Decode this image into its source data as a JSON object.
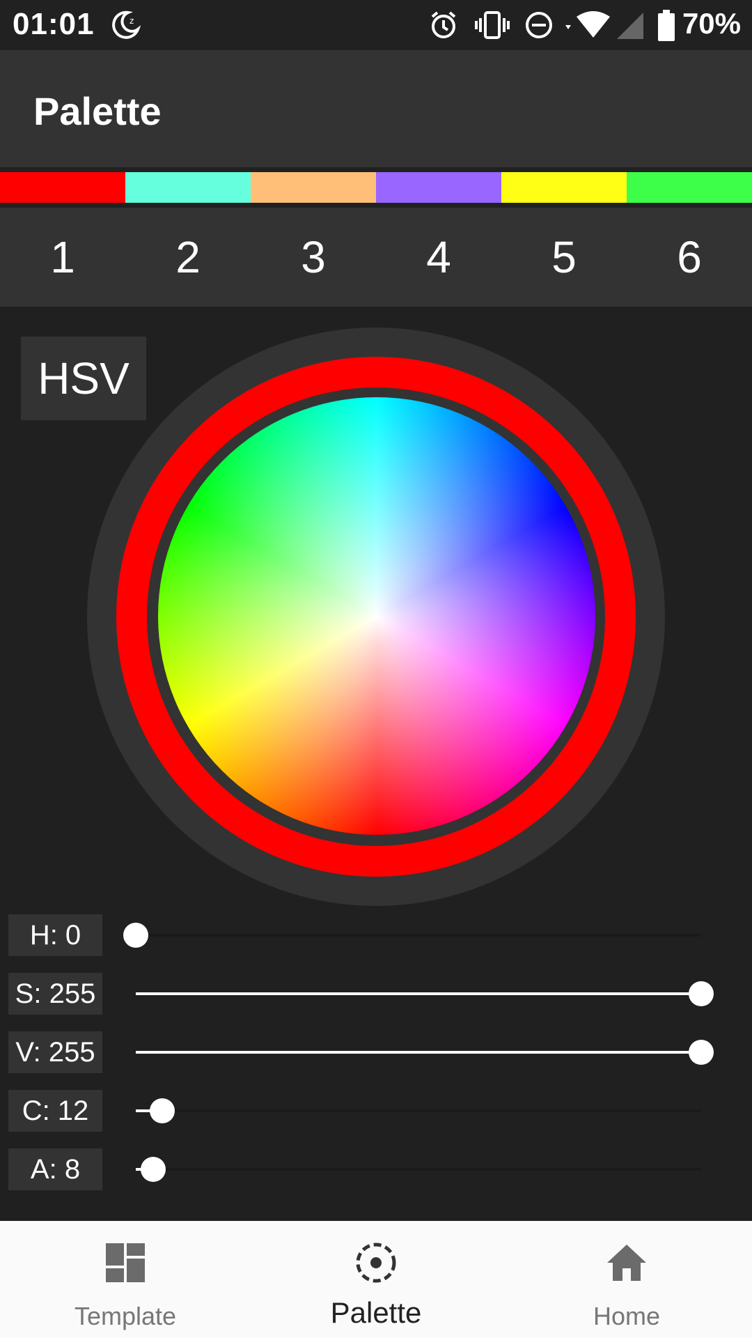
{
  "status_bar": {
    "time": "01:01",
    "battery_percent": "70%",
    "icons": [
      "do-not-disturb-moon-icon",
      "alarm-icon",
      "vibrate-icon",
      "dnd-minus-icon",
      "wifi-icon",
      "cell-signal-icon",
      "battery-icon"
    ]
  },
  "app_bar": {
    "title": "Palette"
  },
  "palette": {
    "swatches": [
      "#ff0000",
      "#66ffdd",
      "#ffbf78",
      "#9966ff",
      "#ffff15",
      "#3dff4a"
    ],
    "tabs": [
      "1",
      "2",
      "3",
      "4",
      "5",
      "6"
    ],
    "active_tab": "1"
  },
  "mode": {
    "label": "HSV"
  },
  "wheel": {
    "selected_color": "#ff0000"
  },
  "sliders": [
    {
      "label": "H: 0",
      "value": 0,
      "max": 255
    },
    {
      "label": "S: 255",
      "value": 255,
      "max": 255
    },
    {
      "label": "V: 255",
      "value": 255,
      "max": 255
    },
    {
      "label": "C: 12",
      "value": 12,
      "max": 255
    },
    {
      "label": "A: 8",
      "value": 8,
      "max": 255
    }
  ],
  "bottom_nav": {
    "items": [
      {
        "label": "Template",
        "icon": "dashboard-icon"
      },
      {
        "label": "Palette",
        "icon": "color-target-icon"
      },
      {
        "label": "Home",
        "icon": "home-icon"
      }
    ],
    "active": "Palette"
  }
}
